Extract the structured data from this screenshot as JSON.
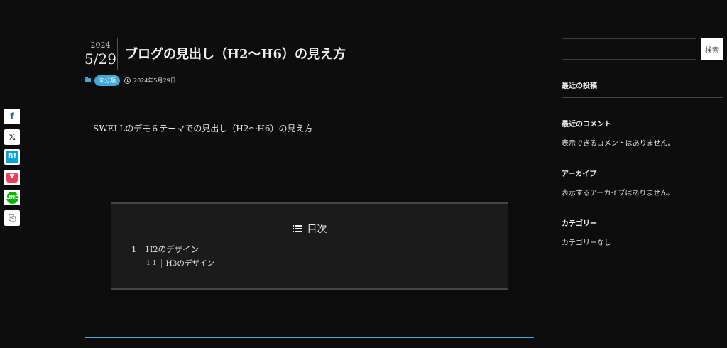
{
  "share": {
    "facebook": {
      "icon": "facebook-icon",
      "glyph": "f"
    },
    "x": {
      "icon": "x-icon",
      "glyph": "𝕏"
    },
    "hatena": {
      "icon": "hatena-bookmark-icon",
      "glyph": "B!"
    },
    "pocket": {
      "icon": "pocket-icon",
      "glyph": "♥"
    },
    "line": {
      "icon": "line-icon",
      "glyph": "LINE"
    },
    "copy": {
      "icon": "clipboard-icon",
      "glyph": "⎘"
    }
  },
  "post": {
    "year": "2024",
    "month_day": "5/29",
    "title": "ブログの見出し（H2〜H6）の見え方",
    "category": "未分類",
    "date": "2024年5月29日",
    "intro": "SWELLのデモ６テーマでの見出し（H2〜H6）の見え方"
  },
  "toc": {
    "title": "目次",
    "items": [
      {
        "num": "1",
        "label": "H2のデザイン"
      },
      {
        "num": "1-1",
        "label": "H3のデザイン"
      }
    ]
  },
  "sidebar": {
    "search": {
      "placeholder": "",
      "button_label": "検索"
    },
    "recent_posts_heading": "最近の投稿",
    "recent_comments_heading": "最近のコメント",
    "recent_comments_text": "表示できるコメントはありません。",
    "archives_heading": "アーカイブ",
    "archives_text": "表示するアーカイブはありません。",
    "categories_heading": "カテゴリー",
    "categories_text": "カテゴリーなし"
  },
  "colors": {
    "background": "#0d0d0e",
    "accent": "#3fa9d9",
    "toc_background": "#1b1b1c"
  }
}
